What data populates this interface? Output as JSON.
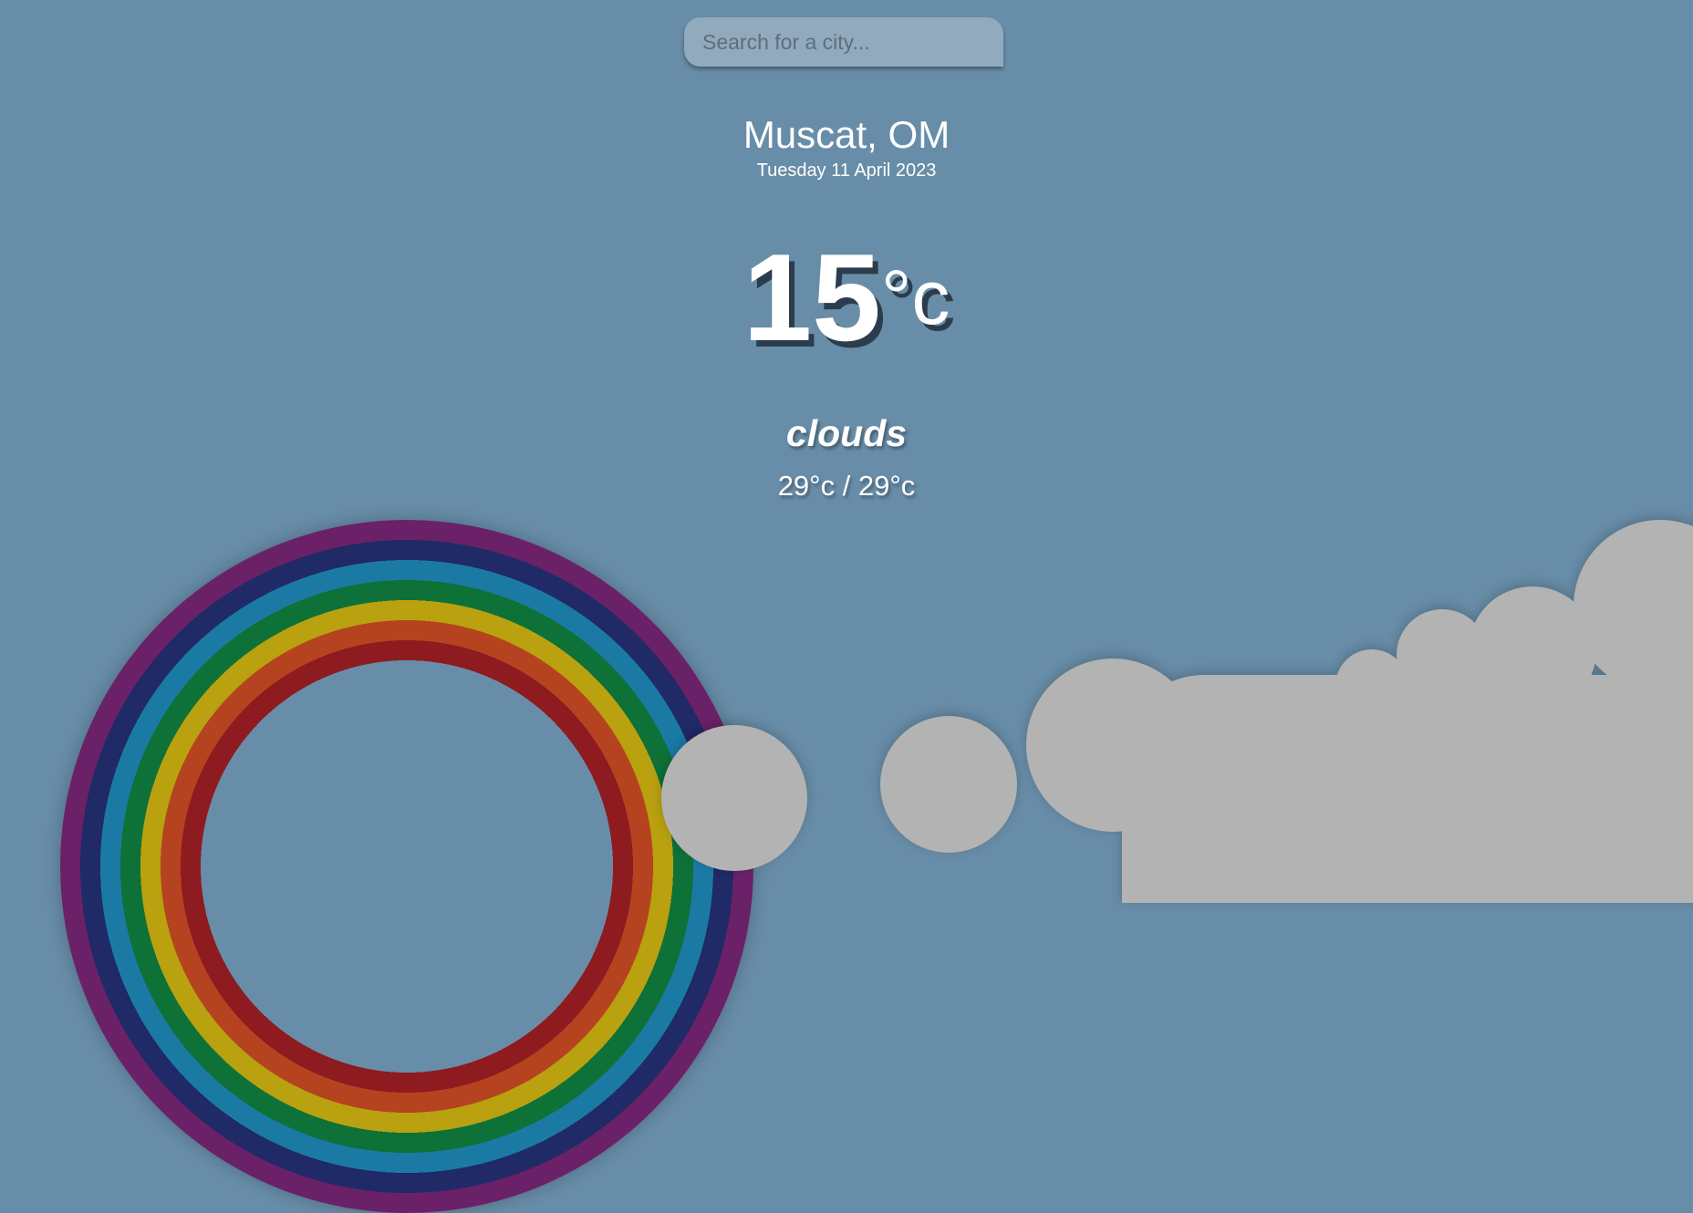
{
  "search": {
    "placeholder": "Search for a city..."
  },
  "location": "Muscat, OM",
  "date": "Tuesday 11 April 2023",
  "temperature": {
    "value": "15",
    "unit": "°c"
  },
  "condition": "clouds",
  "hilo": "29°c / 29°c",
  "colors": {
    "background": "#688da8",
    "rainbow": [
      "#6a2168",
      "#1f2a66",
      "#1b7aa4",
      "#0e7138",
      "#b9a10f",
      "#b6431f",
      "#8e1b20"
    ],
    "cloud": "#b3b3b3"
  }
}
